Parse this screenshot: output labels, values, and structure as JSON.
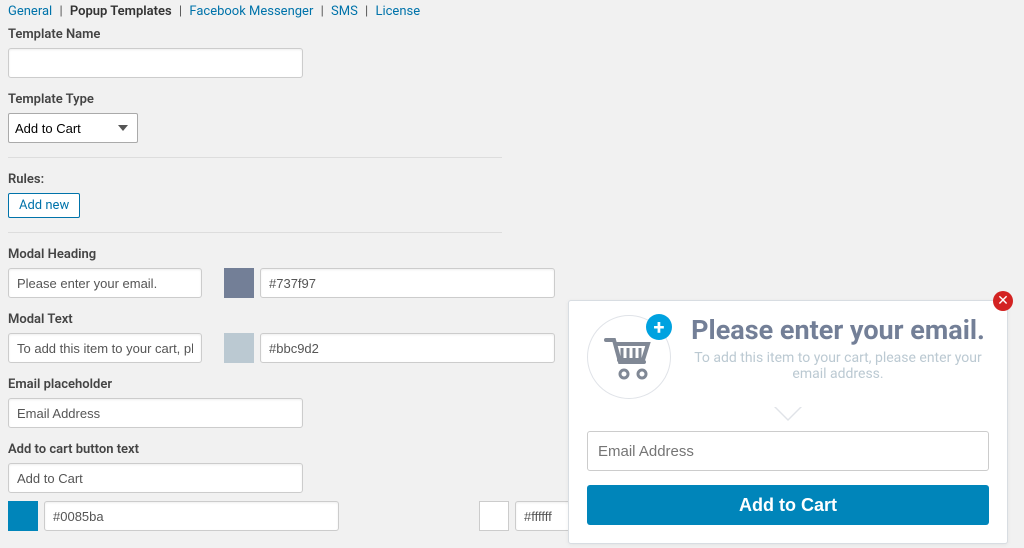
{
  "tabs": {
    "items": [
      "General",
      "Popup Templates",
      "Facebook Messenger",
      "SMS",
      "License"
    ],
    "active_index": 1
  },
  "fields": {
    "template_name": {
      "label": "Template Name",
      "value": ""
    },
    "template_type": {
      "label": "Template Type",
      "value": "Add to Cart"
    },
    "rules": {
      "label": "Rules:",
      "add_new": "Add new"
    },
    "modal_heading": {
      "label": "Modal Heading",
      "value": "Please enter your email.",
      "color": "#737f97"
    },
    "modal_text": {
      "label": "Modal Text",
      "value": "To add this item to your cart, please enter your email address.",
      "color": "#bbc9d2"
    },
    "email_placeholder": {
      "label": "Email placeholder",
      "value": "Email Address"
    },
    "button_text": {
      "label": "Add to cart button text",
      "value": "Add to Cart",
      "bg": "#0085ba",
      "fg": "#ffffff"
    }
  },
  "preview": {
    "heading": "Please enter your email.",
    "subtext": "To add this item to your cart, please enter your email address.",
    "email_placeholder": "Email Address",
    "button": "Add to Cart"
  }
}
